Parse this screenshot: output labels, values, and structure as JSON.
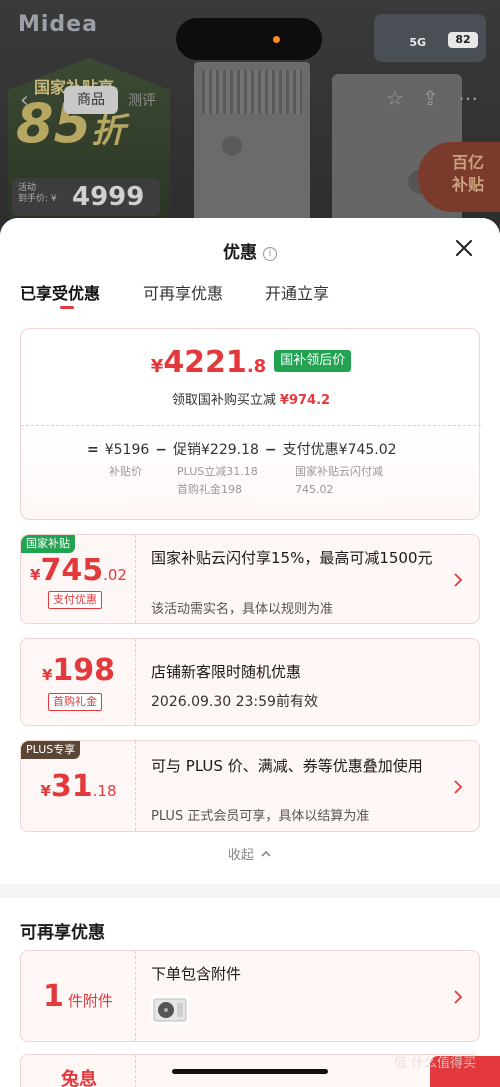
{
  "background": {
    "brand": "Midea",
    "status": {
      "signal": "5G",
      "battery": "82"
    },
    "promo_title": "国家补贴享",
    "promo_discount": "85",
    "promo_discount_unit": "折",
    "price_label": "活动\n到手价: ¥",
    "price_value": "4999",
    "nav_tab_active": "商品",
    "nav_tab_other": "测评",
    "subsidy_badge": "百亿\n补贴"
  },
  "sheet": {
    "title": "优惠",
    "tabs": [
      "已享受优惠",
      "可再享优惠",
      "开通立享"
    ],
    "summary": {
      "final_yen": "¥",
      "final_int": "4221",
      "final_dec": ".8",
      "final_tag": "国补领后价",
      "sub_label": "领取国补购买立减",
      "sub_value": "¥974.2",
      "formula": {
        "base": "¥5196",
        "promo": "促销¥229.18",
        "pay": "支付优惠¥745.02",
        "base_note": "补贴价",
        "promo_note_1": "PLUS立减31.18",
        "promo_note_2": "首购礼金198",
        "pay_note_1": "国家补贴云闪付减",
        "pay_note_2": "745.02"
      }
    },
    "coupons": [
      {
        "corner": "国家补贴",
        "corner_color": "#22a352",
        "yen": "¥",
        "int": "745",
        "dec": ".02",
        "tag": "支付优惠",
        "main": "国家补贴云闪付享15%，最高可减1500元",
        "sub": "该活动需实名，具体以规则为准"
      },
      {
        "yen": "¥",
        "int": "198",
        "dec": "",
        "tag": "首购礼金",
        "main": "店铺新客限时随机优惠",
        "sub": "2026.09.30 23:59前有效"
      },
      {
        "corner": "PLUS专享",
        "corner_color": "#5b4636",
        "yen": "¥",
        "int": "31",
        "dec": ".18",
        "main": "可与 PLUS 价、满减、券等优惠叠加使用",
        "sub": "PLUS 正式会员可享，具体以结算为准"
      }
    ],
    "collapse_label": "收起",
    "section2": {
      "title": "可再享优惠",
      "items": [
        {
          "qty": "1",
          "unit": "件附件",
          "title": "下单包含附件"
        },
        {
          "qty": "兔息",
          "unit": ""
        }
      ]
    }
  },
  "watermark": "值 什么值得买"
}
